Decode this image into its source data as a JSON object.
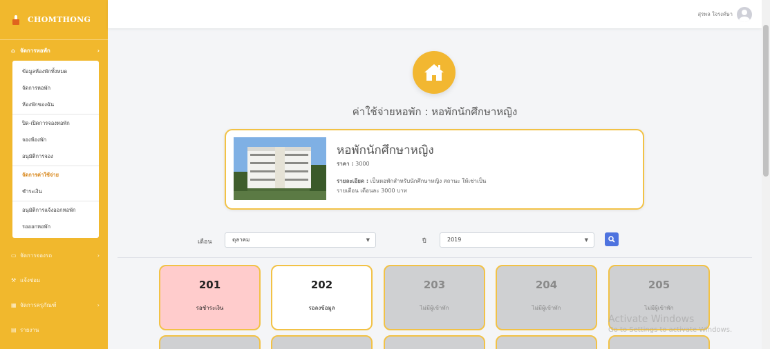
{
  "brand": {
    "name": "CHOMTHONG"
  },
  "sidebar": {
    "section_dorm": "จัดการหอพัก",
    "sub_items": [
      "ข้อมูลห้องพักทั้งหมด",
      "จัดการหอพัก",
      "ห้องพักของฉัน",
      "ปิด-เปิดการจองหอพัก",
      "จองห้องพัก",
      "อนุมัติการจอง",
      "จัดการค่าใช้จ่าย",
      "ชำระเงิน",
      "อนุมัติการแจ้งออกหอพัก",
      "รอออกหอพัก"
    ],
    "section_booking": "จัดการจองรถ",
    "section_report_repair": "แจ้งซ่อม",
    "section_equipment": "จัดการครุภัณฑ์",
    "section_report": "รายงาน"
  },
  "topbar": {
    "username": "สุรพล ใจรงค์ษา"
  },
  "page": {
    "title": "ค่าใช้จ่ายหอพัก : หอพักนักศึกษาหญิง"
  },
  "dorm": {
    "name": "หอพักนักศึกษาหญิง",
    "price_label": "ราคา :",
    "price_value": "3000",
    "detail_label": "รายละเอียด :",
    "detail_line1": "เป็นหอพักสำหรับนักศึกษาหญิง สถานะ ให้เช่าเป็น",
    "detail_line2": "รายเดือน เดือนละ 3000 บาท"
  },
  "filter": {
    "month_label": "เดือน",
    "month_value": "ตุลาคม",
    "year_label": "ปี",
    "year_value": "2019"
  },
  "rooms": [
    {
      "number": "201",
      "status": "รอชำระเงิน"
    },
    {
      "number": "202",
      "status": "รอลงข้อมูล"
    },
    {
      "number": "203",
      "status": "ไม่มีผู้เข้าพัก"
    },
    {
      "number": "204",
      "status": "ไม่มีผู้เข้าพัก"
    },
    {
      "number": "205",
      "status": "ไม่มีผู้เข้าพัก"
    }
  ],
  "colors": {
    "sidebar": "#f1b82d",
    "accent": "#f2c246",
    "search_button": "#4e73df",
    "pending_payment": "#ffcccc",
    "vacant": "#cfd0d2"
  },
  "watermark": {
    "line1": "Activate Windows",
    "line2": "Go to Settings to activate Windows."
  }
}
